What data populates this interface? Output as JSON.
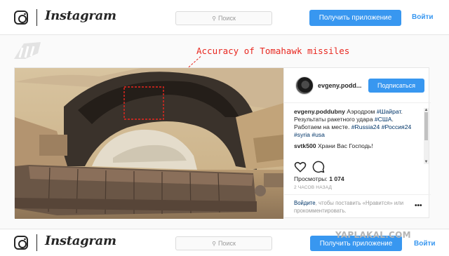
{
  "header": {
    "wordmark": "Instagram",
    "search_placeholder": "Поиск",
    "get_app_label": "Получить приложение",
    "login_label": "Войти"
  },
  "overlay": {
    "caption": "Accuracy of Tomahawk missiles",
    "accent_color": "#e8271f",
    "watermark_text": "YAPLAKAL.COM"
  },
  "post": {
    "username_short": "evgeny.podd...",
    "follow_label": "Подписаться",
    "comments": [
      {
        "user": "evgeny.poddubny",
        "text_before": "Аэродром ",
        "tags_line1": "#Шайрат",
        "text_mid": ". Результаты ракетного удара ",
        "tag2": "#США",
        "text_after": ". Работаем на месте. ",
        "tag3": "#Russia24",
        "tag4": "#Россия24",
        "tag5": "#syria",
        "tag6": "#usa"
      },
      {
        "user": "svtk500",
        "text": "Храни Вас Господь!"
      }
    ],
    "views_label": "Просмотры:",
    "views_value": "1 074",
    "time_ago": "2 ЧАСОВ НАЗАД",
    "login_prompt_link": "Войдите",
    "login_prompt_text": ", чтобы поставить «Нравится» или прокомментировать.",
    "more_icon": "more-dots-icon"
  },
  "colors": {
    "brand_blue": "#3897f0",
    "text_dark": "#262626",
    "muted": "#999999"
  }
}
